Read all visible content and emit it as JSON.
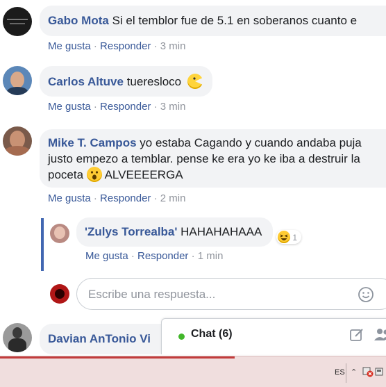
{
  "comments": [
    {
      "author": "Gabo Mota",
      "text": "Si el temblor fue de 5.1 en soberanos cuanto e",
      "like": "Me gusta",
      "sep": "·",
      "reply": "Responder",
      "time": "3 min"
    },
    {
      "author": "Carlos Altuve",
      "text": "tueresloco",
      "like": "Me gusta",
      "sep": "·",
      "reply": "Responder",
      "time": "3 min"
    },
    {
      "author": "Mike T. Campos",
      "text_line1": "yo estaba Cagando y cuando andaba puja",
      "text_line2": "justo empezo a temblar. pense ke era yo ke iba a destruir la",
      "text_line3": "poceta",
      "text_line3_after": "ALVEEEERGA",
      "like": "Me gusta",
      "sep": "·",
      "reply": "Responder",
      "time": "2 min"
    },
    {
      "author": "'Zulys Torrealba'",
      "text": "HAHAHAHAAA",
      "reaction_count": "1",
      "like": "Me gusta",
      "sep": "·",
      "reply": "Responder",
      "time": "1 min"
    },
    {
      "author": "Davian AnTonio Vi"
    }
  ],
  "reply_box": {
    "placeholder": "Escribe una respuesta..."
  },
  "chat": {
    "label": "Chat (6)"
  },
  "taskbar": {
    "language": "ES"
  },
  "icons": {
    "emoji_smile": "smile-icon",
    "compose": "compose-icon",
    "friends": "friends-icon"
  },
  "colors": {
    "link": "#385898",
    "online": "#42b72a",
    "bubble": "#f2f3f5"
  }
}
